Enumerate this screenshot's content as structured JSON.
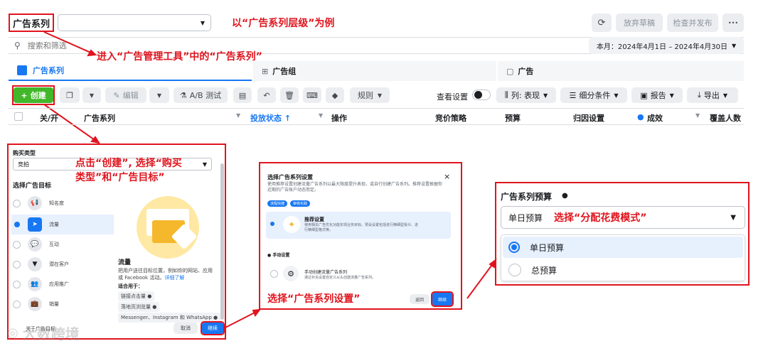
{
  "topbar": {
    "title": "广告系列",
    "annotation": "以“广告系列层级”为例",
    "discard_label": "放弃草稿",
    "review_label": "检查并发布",
    "more_label": "•••"
  },
  "searchbar": {
    "placeholder": "搜索和筛选",
    "date_label": "本月：2024年4月1日 – 2024年4月30日",
    "annotation": "进入“广告管理工具”中的“广告系列”"
  },
  "tabs": [
    {
      "label": "广告系列"
    },
    {
      "label": "广告组"
    },
    {
      "label": "广告"
    }
  ],
  "toolbar": {
    "create": "创建",
    "edit": "编辑",
    "abtest": "A/B 测试",
    "rules": "规则",
    "view_settings": "查看设置",
    "columns": "列: 表现",
    "breakdown": "细分条件",
    "report": "报告",
    "export": "导出"
  },
  "table_header": {
    "onoff": "关/开",
    "campaign": "广告系列",
    "delivery": "投放状态 ↑",
    "actions": "操作",
    "bid": "竞价策略",
    "budget": "预算",
    "attribution": "归因设置",
    "results": "成效",
    "reach": "覆盖人数"
  },
  "panel1": {
    "buy_type_label": "购买类型",
    "buy_type_value": "竞拍",
    "objective_title": "选择广告目标",
    "objectives": [
      "知名度",
      "流量",
      "互动",
      "潜在客户",
      "应用推广",
      "销量"
    ],
    "detail_title": "流量",
    "detail_desc": "把用户送往目标位置，例如你的网站、应用或 Facebook 活动。",
    "detail_link": "详细了解",
    "good_for": "适合用于：",
    "tags": [
      "链接点击量",
      "落地页浏览量",
      "Messenger、Instagram 和 WhatsApp"
    ],
    "cancel": "取消",
    "continue": "继续",
    "footer_text": "关于广告目标",
    "annotation_line1": "点击“创建”, 选择“购买",
    "annotation_line2": "类型”和“广告目标”"
  },
  "panel2": {
    "title": "选择广告系列设置",
    "desc": "使用推荐设置创建流量广告系列以最大限度提升表现，或自行创建广告系列。推荐设置根据你近期的广告账户动态而定。",
    "pills": [
      "流程快捷",
      "审核实践"
    ],
    "rec_title": "推荐设置",
    "rec_desc": "使用相关广告优化功能实现业务目标。预设设置包括进行精细型受众、进行精细型格式等。",
    "manual_header": "手动设置",
    "manual_title": "手动创建流量广告系列",
    "manual_desc": "通过补充设置自定义从头创建流量广告系列。",
    "back": "返回",
    "continue": "继续",
    "annotation": "选择“广告系列设置”",
    "close": "×"
  },
  "panel3": {
    "title": "广告系列预算",
    "select_value": "单日预算",
    "annotation": "选择“分配花费模式”",
    "options": [
      "单日预算",
      "总预算"
    ]
  },
  "watermark": "大数跨境",
  "colors": {
    "red": "#e0141e",
    "green": "#42b72a",
    "blue": "#1877f2",
    "navy": "#2d4a8a"
  }
}
